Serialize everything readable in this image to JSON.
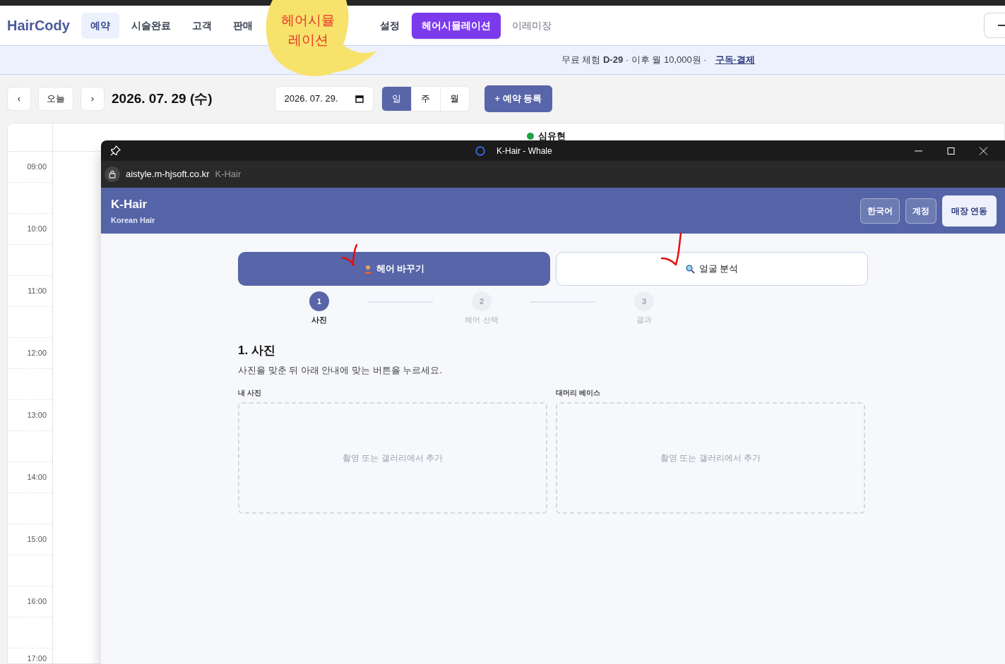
{
  "app": {
    "logo": "HairCody",
    "nav": [
      {
        "label": "예약",
        "selected": true
      },
      {
        "label": "시술완료",
        "selected": false
      },
      {
        "label": "고객",
        "selected": false
      },
      {
        "label": "판매",
        "selected": false
      },
      {
        "label": "설정",
        "selected": false
      }
    ],
    "simulation_button": "헤어시뮬레이션",
    "store_name": "이레미장",
    "banner": {
      "text": "무료 체험 **D-29** · 이후 월 10,000원 ·",
      "link": "구독·결제"
    },
    "toolbar": {
      "prev": "‹",
      "today": "오늘",
      "next": "›",
      "date_title": "2026. 07. 29 (수)",
      "date_field": "2026. 07. 29.",
      "views": [
        {
          "label": "일",
          "selected": true
        },
        {
          "label": "주",
          "selected": false
        },
        {
          "label": "월",
          "selected": false
        }
      ],
      "add_button": "+ 예약 등록"
    },
    "calendar": {
      "staff": [
        {
          "name": "심유현",
          "color": "#22a04b"
        }
      ],
      "times": [
        "09:00",
        "10:00",
        "11:00",
        "12:00",
        "13:00",
        "14:00",
        "15:00",
        "16:00",
        "17:00"
      ]
    }
  },
  "annotation": {
    "bubble_lines": [
      "헤어시뮬",
      "레이션"
    ]
  },
  "popup": {
    "title": "K-Hair - Whale",
    "url": "aistyle.m-hjsoft.co.kr",
    "page_title": "K-Hair",
    "header": {
      "title": "K-Hair",
      "subtitle": "Korean Hair",
      "buttons": [
        {
          "label": "한국어",
          "kind": "ghost"
        },
        {
          "label": "계정",
          "kind": "ghost"
        },
        {
          "label": "매장 연동",
          "kind": "solid"
        }
      ]
    },
    "modes": [
      {
        "label": "헤어 바꾸기",
        "selected": true
      },
      {
        "label": "얼굴 분석",
        "selected": false
      }
    ],
    "steps": [
      {
        "number": "1",
        "label": "사진",
        "selected": true
      },
      {
        "number": "2",
        "label": "헤어 선택",
        "selected": false
      },
      {
        "number": "3",
        "label": "결과",
        "selected": false
      }
    ],
    "section_title": "1. 사진",
    "description": "사진을 맞춘 뒤 아래 안내에 맞는 버튼을 누르세요.",
    "uploads": [
      {
        "label": "내 사진",
        "hint": "촬영 또는 갤러리에서 추가"
      },
      {
        "label": "대머리 베이스",
        "hint": "촬영 또는 갤러리에서 추가"
      }
    ]
  }
}
